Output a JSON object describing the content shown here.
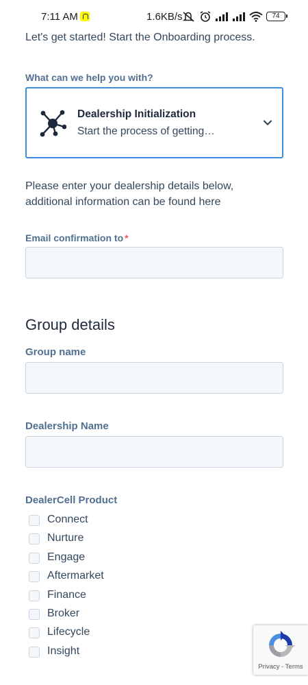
{
  "status_bar": {
    "time": "7:11 AM",
    "network_speed": "1.6KB/s",
    "battery": "74",
    "icons": [
      "snapchat-icon",
      "mute-icon",
      "alarm-icon",
      "signal-icon",
      "signal-icon",
      "wifi-icon",
      "battery-icon"
    ]
  },
  "intro_text": "Let's get started! Start the Onboarding process.",
  "help_field": {
    "label": "What can we help you with?",
    "selected_title": "Dealership Initialization",
    "selected_description": "Start the process of getting…",
    "icon": "network-icon"
  },
  "instructions": {
    "line1": "Please enter your dealership details below,",
    "line2": "additional information can be found here"
  },
  "email_field": {
    "label": "Email confirmation to",
    "required_marker": "*",
    "value": ""
  },
  "group_section": {
    "title": "Group details",
    "group_name_label": "Group name",
    "group_name_value": "",
    "dealership_name_label": "Dealership Name",
    "dealership_name_value": ""
  },
  "product_field": {
    "label": "DealerCell Product",
    "options": [
      {
        "label": "Connect",
        "checked": false
      },
      {
        "label": "Nurture",
        "checked": false
      },
      {
        "label": "Engage",
        "checked": false
      },
      {
        "label": "Aftermarket",
        "checked": false
      },
      {
        "label": "Finance",
        "checked": false
      },
      {
        "label": "Broker",
        "checked": false
      },
      {
        "label": "Lifecycle",
        "checked": false
      },
      {
        "label": "Insight",
        "checked": false
      }
    ]
  },
  "recaptcha": {
    "privacy": "Privacy",
    "separator": " - ",
    "terms": "Terms"
  },
  "colors": {
    "accent_border": "#3b8ee0",
    "label": "#516f90",
    "required": "#f2545b",
    "field_bg": "#f5f8fa"
  }
}
